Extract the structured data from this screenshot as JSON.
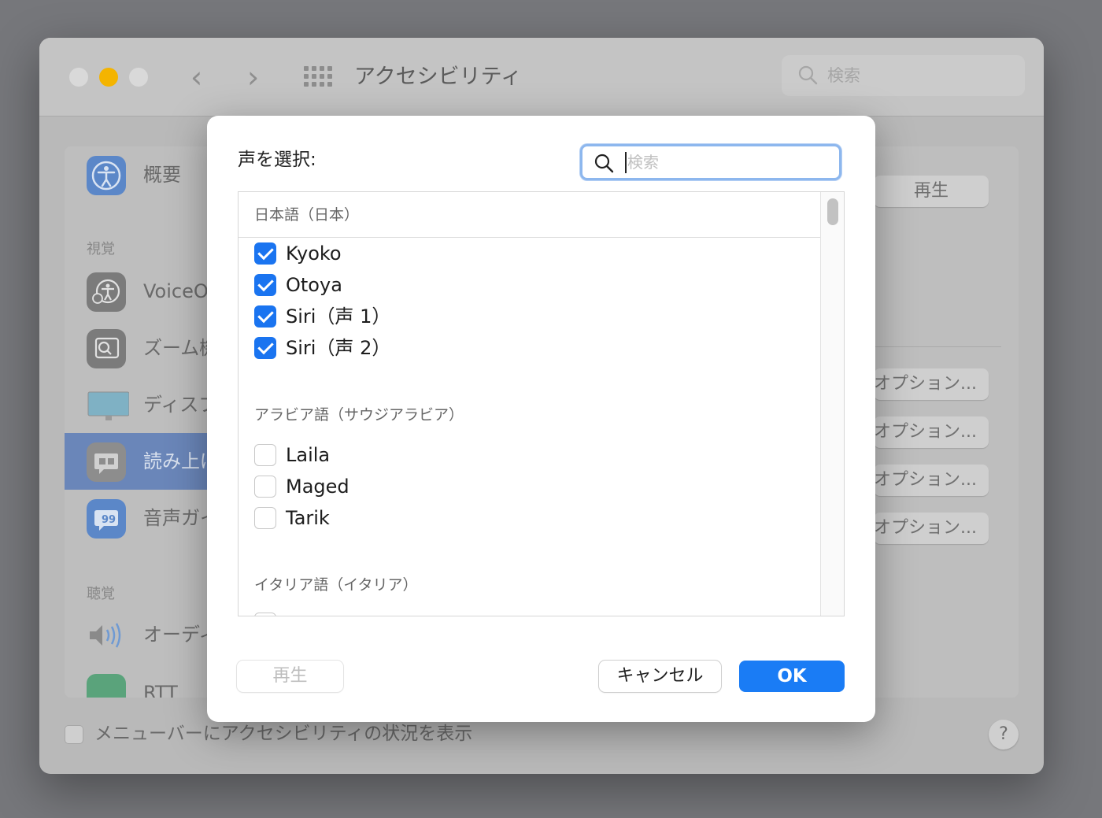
{
  "window": {
    "title": "アクセシビリティ",
    "search_placeholder": "検索"
  },
  "sidebar": {
    "items": [
      {
        "label": "概要",
        "icon": "accessibility-icon"
      },
      {
        "label": "VoiceO",
        "icon": "voiceover-icon"
      },
      {
        "label": "ズーム機",
        "icon": "zoom-icon"
      },
      {
        "label": "ディスプ",
        "icon": "display-icon"
      },
      {
        "label": "読み上げ",
        "icon": "speech-icon"
      },
      {
        "label": "音声ガイ",
        "icon": "voice-guide-icon"
      },
      {
        "label": "オーディ",
        "icon": "audio-icon"
      },
      {
        "label": "RTT",
        "icon": "rtt-phone-icon"
      }
    ],
    "sections": {
      "vision": "視覚",
      "hearing": "聴覚"
    }
  },
  "background_buttons": {
    "play": "再生",
    "options": [
      "オプション...",
      "オプション...",
      "オプション...",
      "オプション..."
    ]
  },
  "bottom": {
    "menu_status_label": "メニューバーにアクセシビリティの状況を表示",
    "help": "?"
  },
  "dialog": {
    "title": "声を選択:",
    "search_placeholder": "検索",
    "groups": [
      {
        "label": "日本語（日本）",
        "voices": [
          {
            "name": "Kyoko",
            "checked": true
          },
          {
            "name": "Otoya",
            "checked": true
          },
          {
            "name": "Siri（声 1）",
            "checked": true
          },
          {
            "name": "Siri（声 2）",
            "checked": true
          }
        ]
      },
      {
        "label": "アラビア語（サウジアラビア）",
        "voices": [
          {
            "name": "Laila",
            "checked": false
          },
          {
            "name": "Maged",
            "checked": false
          },
          {
            "name": "Tarik",
            "checked": false
          }
        ]
      },
      {
        "label": "イタリア語（イタリア）",
        "voices": []
      }
    ],
    "buttons": {
      "play": "再生",
      "cancel": "キャンセル",
      "ok": "OK"
    }
  },
  "colors": {
    "accent": "#1a7cf5",
    "checkbox_on": "#1a74f0",
    "selected_sidebar": "#6a86b9",
    "minimize_light": "#f4b400"
  }
}
